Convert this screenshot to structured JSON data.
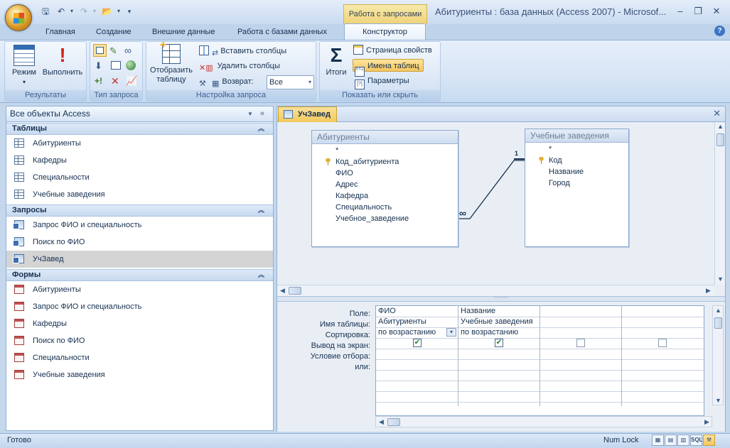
{
  "window": {
    "title": "Абитуриенты : база данных (Access 2007) - Microsof...",
    "context_group": "Работа с запросами"
  },
  "qat": {
    "icons": [
      "save-icon",
      "undo-icon",
      "redo-icon",
      "open-icon",
      "customize-icon"
    ]
  },
  "tabs": [
    "Главная",
    "Создание",
    "Внешние данные",
    "Работа с базами данных",
    "Конструктор"
  ],
  "ribbon": {
    "results": {
      "caption": "Результаты",
      "view": "Режим",
      "run": "Выполнить"
    },
    "query_type": {
      "caption": "Тип запроса"
    },
    "setup": {
      "caption": "Настройка запроса",
      "show_table": "Отобразить таблицу",
      "insert_cols": "Вставить столбцы",
      "delete_cols": "Удалить столбцы",
      "return_label": "Возврат:",
      "return_value": "Все"
    },
    "show_hide": {
      "caption": "Показать или скрыть",
      "totals": "Итоги",
      "property_sheet": "Страница свойств",
      "table_names": "Имена таблиц",
      "parameters": "Параметры"
    }
  },
  "nav": {
    "header": "Все объекты Access",
    "tables_header": "Таблицы",
    "tables": [
      "Абитуриенты",
      "Кафедры",
      "Специальности",
      "Учебные заведения"
    ],
    "queries_header": "Запросы",
    "queries": [
      "Запрос ФИО и специальность",
      "Поиск по ФИО",
      "УчЗавед"
    ],
    "forms_header": "Формы",
    "forms": [
      "Абитуриенты",
      "Запрос ФИО и специальность",
      "Кафедры",
      "Поиск по ФИО",
      "Специальности",
      "Учебные заведения"
    ]
  },
  "doc": {
    "tab": "УчЗавед",
    "table1": {
      "title": "Абитуриенты",
      "fields": [
        "*",
        "Код_абитуриента",
        "ФИО",
        "Адрес",
        "Кафедра",
        "Специальность",
        "Учебное_заведение"
      ]
    },
    "table2": {
      "title": "Учебные заведения",
      "fields": [
        "*",
        "Код",
        "Название",
        "Город"
      ]
    },
    "rel_one": "1",
    "rel_many": "∞",
    "row_labels": [
      "Поле:",
      "Имя таблицы:",
      "Сортировка:",
      "Вывод на экран:",
      "Условие отбора:",
      "или:"
    ],
    "col1": {
      "field": "ФИО",
      "table": "Абитуриенты",
      "sort": "по возрастанию",
      "show": true
    },
    "col2": {
      "field": "Название",
      "table": "Учебные заведения",
      "sort": "по возрастанию",
      "show": true
    },
    "col3": {
      "show": false
    },
    "col4": {
      "show": false
    }
  },
  "status": {
    "left": "Готово",
    "numlock": "Num Lock",
    "view_icons": [
      "datasheet-view-icon",
      "pivottable-view-icon",
      "pivotchart-view-icon",
      "sql-view-icon",
      "design-view-icon"
    ],
    "sql_label": "SQL"
  }
}
